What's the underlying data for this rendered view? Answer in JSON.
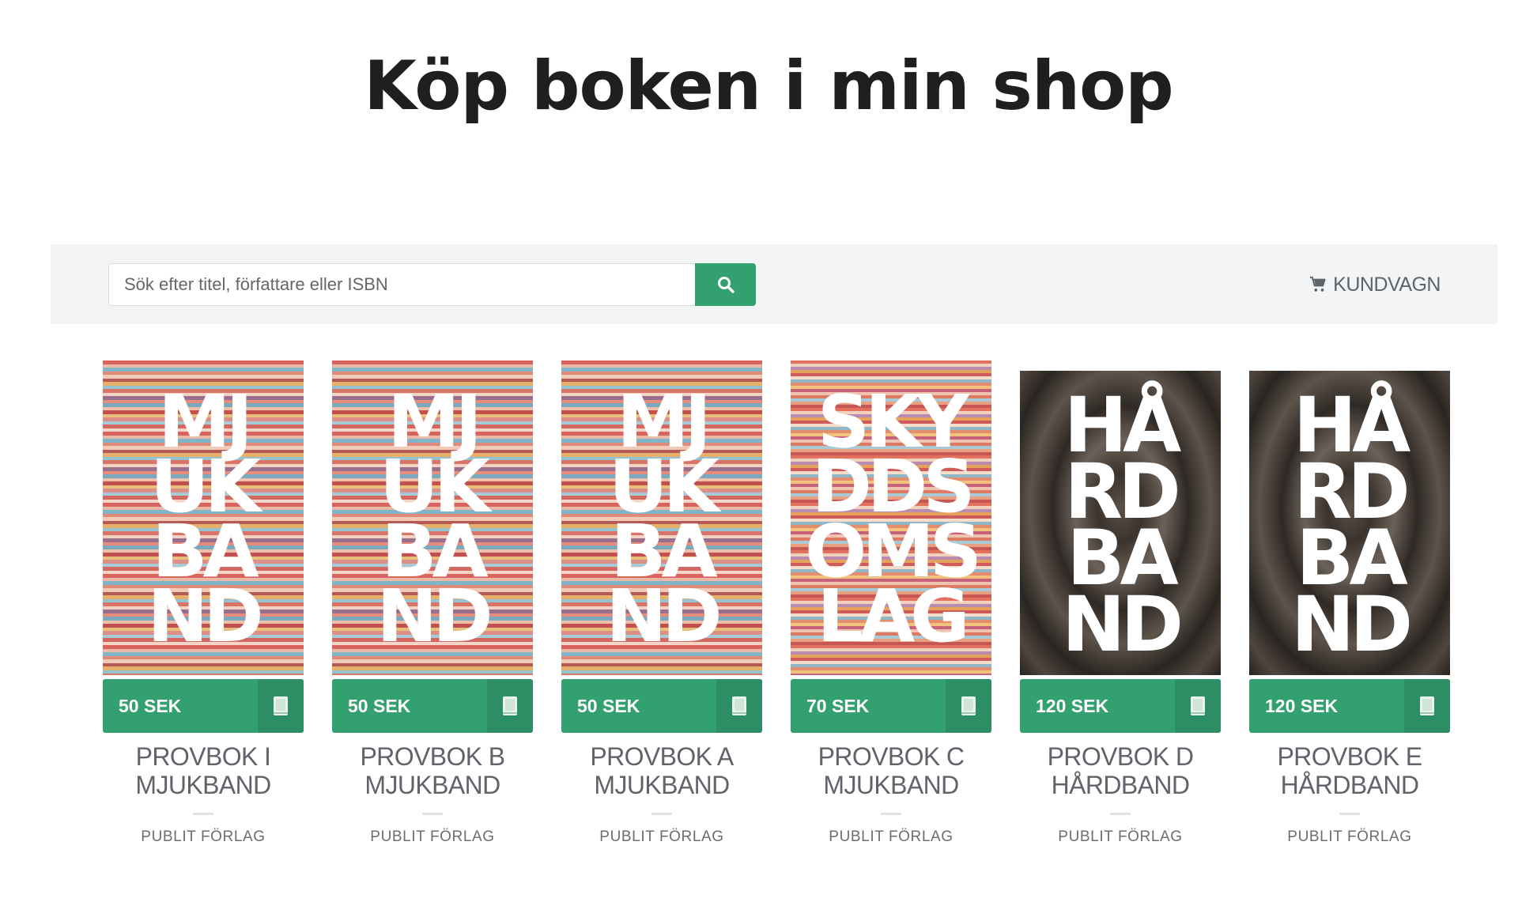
{
  "page": {
    "title": "Köp boken i min shop"
  },
  "toolbar": {
    "search_placeholder": "Sök efter titel, författare eller ISBN",
    "search_icon": "search-icon",
    "cart_label": "KUNDVAGN",
    "cart_icon": "cart-icon"
  },
  "colors": {
    "accent": "#33a070",
    "accent_dark": "#2d8d64",
    "toolbar_bg": "#f3f4f5",
    "title_text": "#1f1f1f"
  },
  "products": [
    {
      "price": "50 SEK",
      "title_line1": "PROVBOK I",
      "title_line2": "MJUKBAND",
      "publisher": "PUBLIT FÖRLAG",
      "cover_lines": [
        "MJ",
        "UK",
        "BA",
        "ND"
      ],
      "cover_style": "woven-rug",
      "format_icon": "book-icon"
    },
    {
      "price": "50 SEK",
      "title_line1": "PROVBOK B",
      "title_line2": "MJUKBAND",
      "publisher": "PUBLIT FÖRLAG",
      "cover_lines": [
        "MJ",
        "UK",
        "BA",
        "ND"
      ],
      "cover_style": "woven-rug",
      "format_icon": "book-icon"
    },
    {
      "price": "50 SEK",
      "title_line1": "PROVBOK A",
      "title_line2": "MJUKBAND",
      "publisher": "PUBLIT FÖRLAG",
      "cover_lines": [
        "MJ",
        "UK",
        "BA",
        "ND"
      ],
      "cover_style": "woven-rug",
      "format_icon": "book-icon"
    },
    {
      "price": "70 SEK",
      "title_line1": "PROVBOK C",
      "title_line2": "MJUKBAND",
      "publisher": "PUBLIT FÖRLAG",
      "cover_lines": [
        "SKY",
        "DDS",
        "OMS",
        "LAG"
      ],
      "cover_style": "woven-rug-dense",
      "format_icon": "book-icon"
    },
    {
      "price": "120 SEK",
      "title_line1": "PROVBOK D",
      "title_line2": "HÅRDBAND",
      "publisher": "PUBLIT FÖRLAG",
      "cover_lines": [
        "HÅ",
        "RD",
        "BA",
        "ND"
      ],
      "cover_style": "wood-grain",
      "format_icon": "book-icon"
    },
    {
      "price": "120 SEK",
      "title_line1": "PROVBOK E",
      "title_line2": "HÅRDBAND",
      "publisher": "PUBLIT FÖRLAG",
      "cover_lines": [
        "HÅ",
        "RD",
        "BA",
        "ND"
      ],
      "cover_style": "wood-grain",
      "format_icon": "book-icon"
    }
  ]
}
